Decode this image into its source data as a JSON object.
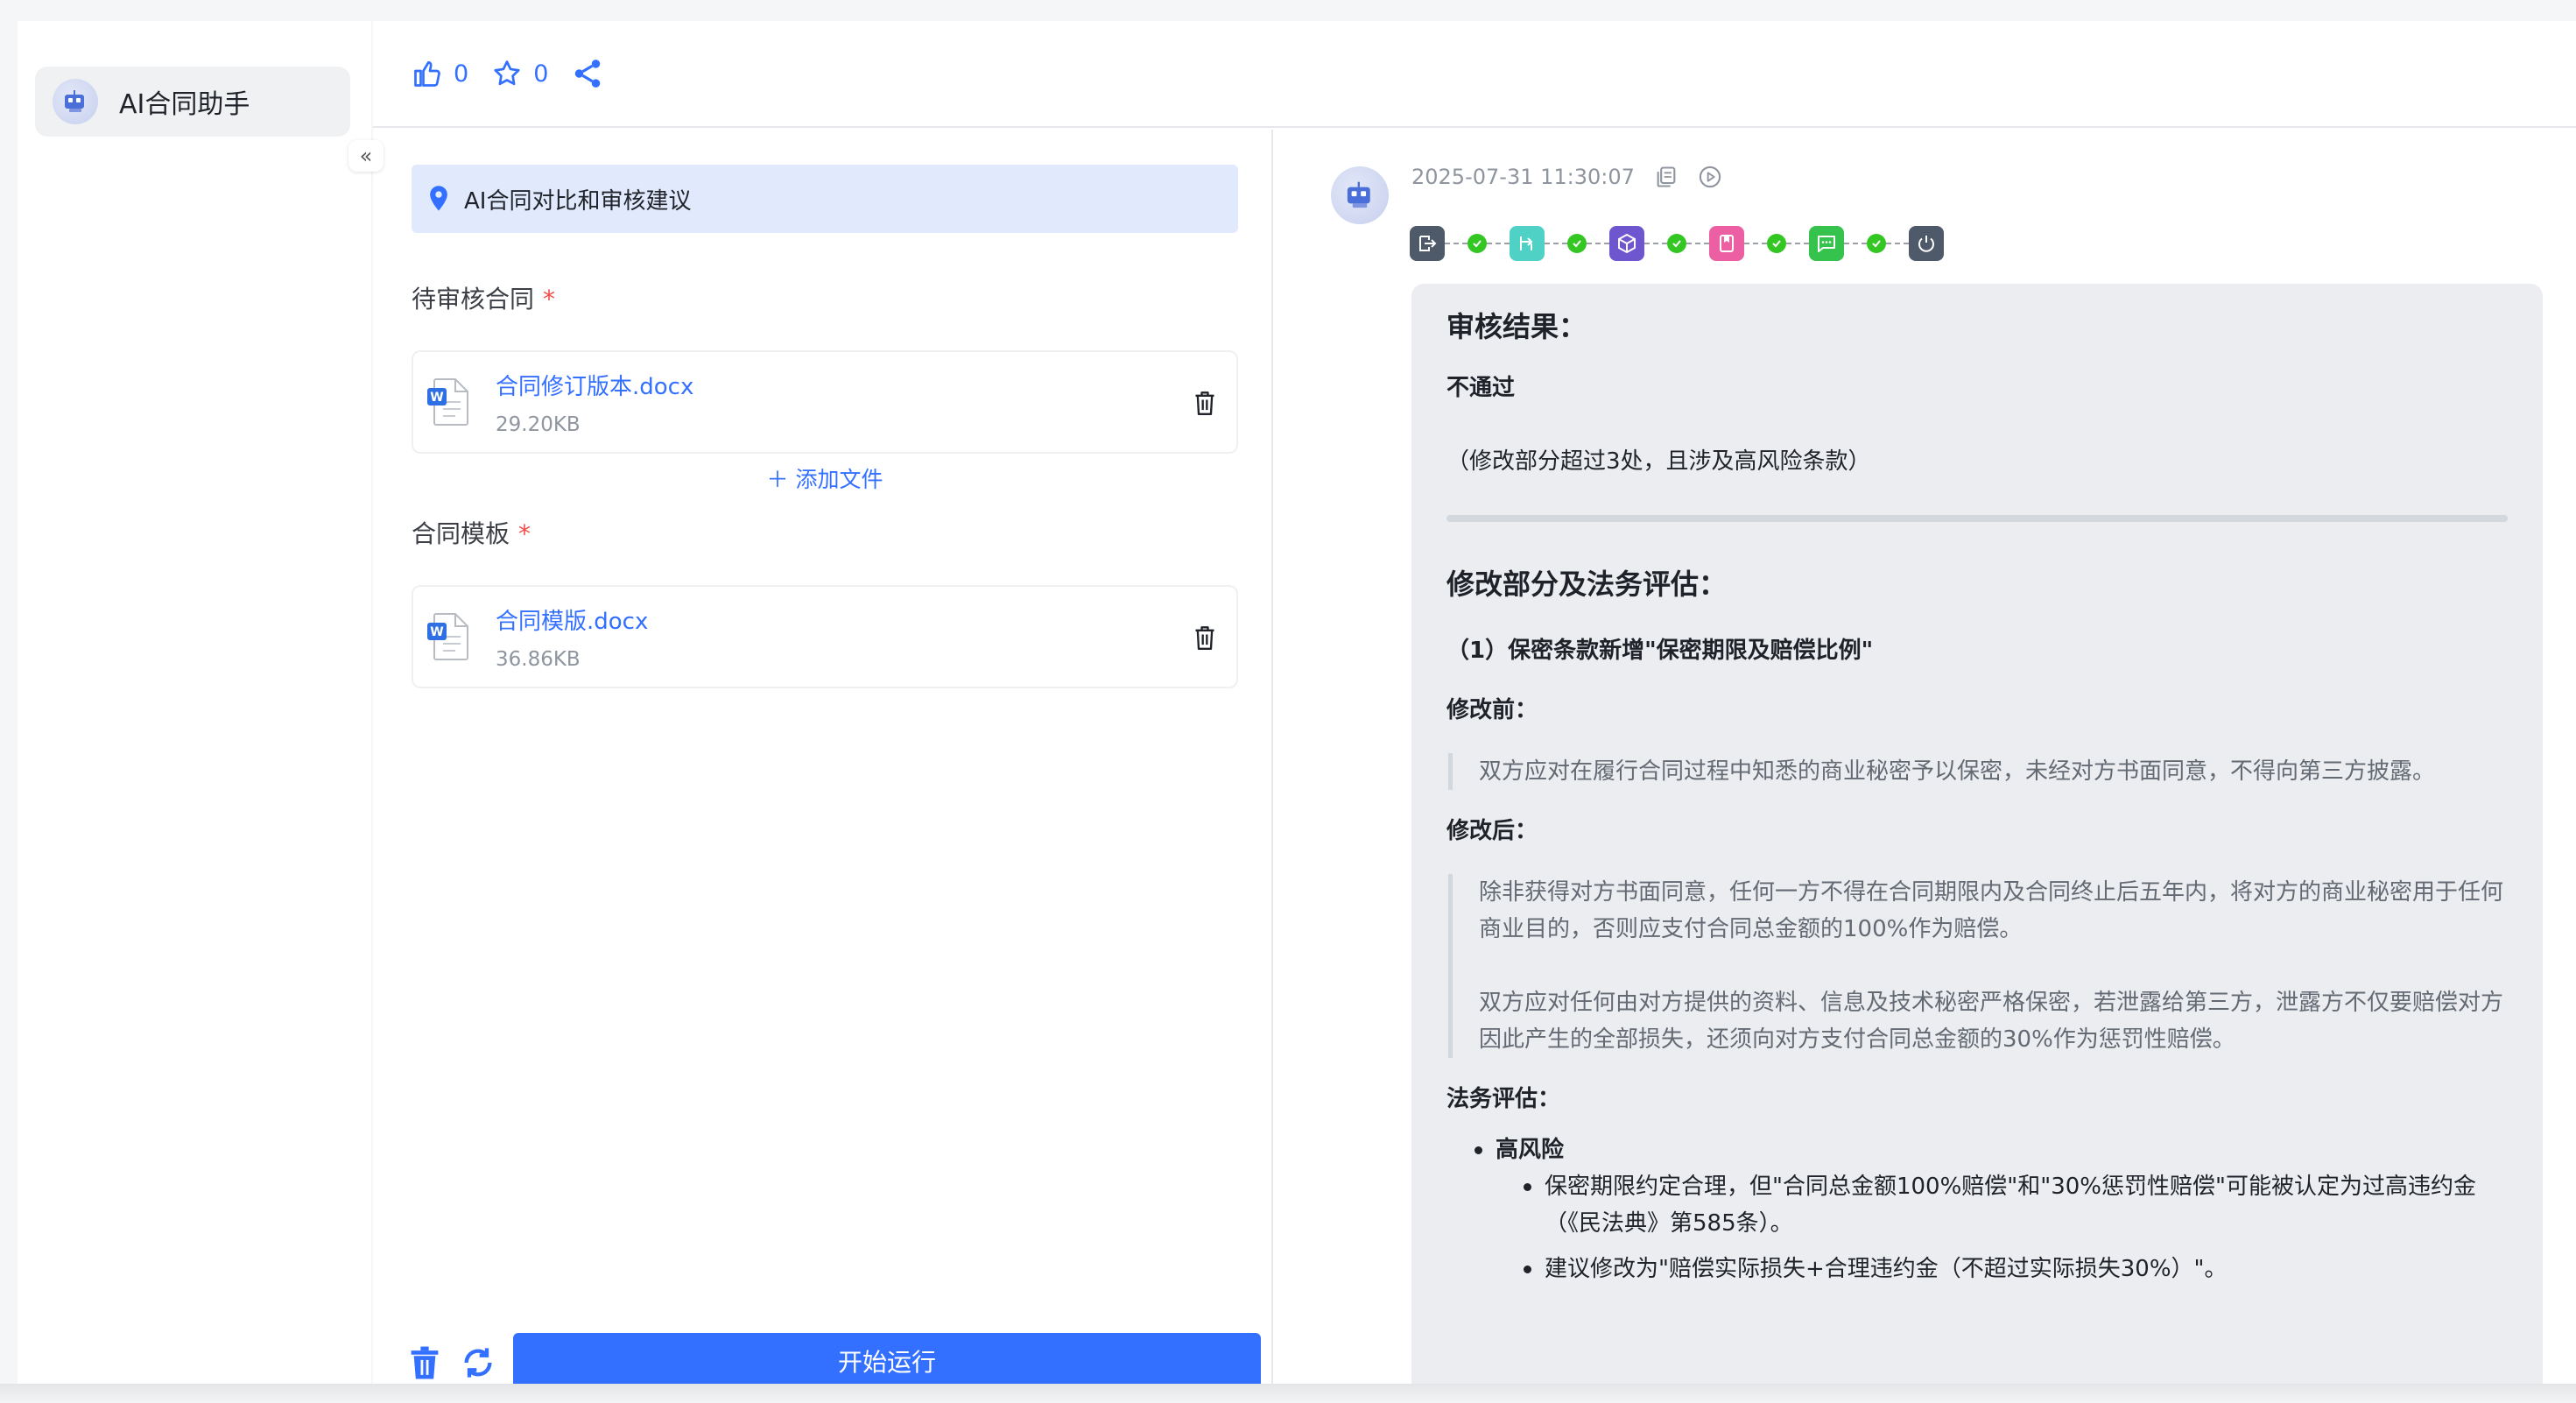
{
  "sidebar": {
    "app_name": "AI合同助手",
    "collapse_glyph": "«"
  },
  "toolbar": {
    "like_count": "0",
    "star_count": "0"
  },
  "form": {
    "banner_title": "AI合同对比和审核建议",
    "contract_label": "待审核合同",
    "template_label": "合同模板",
    "required_mark": "*",
    "contract_file": {
      "name": "合同修订版本.docx",
      "size": "29.20KB"
    },
    "template_file": {
      "name": "合同模版.docx",
      "size": "36.86KB"
    },
    "add_file_label": "＋ 添加文件",
    "run_label": "开始运行"
  },
  "result": {
    "timestamp": "2025-07-31 11:30:07",
    "workflow_colors": [
      "#4e5969",
      "#4fd1c5",
      "#6e56cf",
      "#ec5fa3",
      "#36c34d",
      "#4e5969"
    ],
    "audit_heading": "审核结果：",
    "verdict": "不通过",
    "verdict_reason": "（修改部分超过3处，且涉及高风险条款）",
    "changes_heading": "修改部分及法务评估：",
    "item1_title": "（1）保密条款新增\"保密期限及赔偿比例\"",
    "before_label": "修改前：",
    "before_text": "双方应对在履行合同过程中知悉的商业秘密予以保密，未经对方书面同意，不得向第三方披露。",
    "after_label": "修改后：",
    "after_text_1": "除非获得对方书面同意，任何一方不得在合同期限内及合同终止后五年内，将对方的商业秘密用于任何商业目的，否则应支付合同总金额的100%作为赔偿。",
    "after_text_2": "双方应对任何由对方提供的资料、信息及技术秘密严格保密，若泄露给第三方，泄露方不仅要赔偿对方因此产生的全部损失，还须向对方支付合同总金额的30%作为惩罚性赔偿。",
    "legal_label": "法务评估：",
    "risk_level": "高风险",
    "risk_points": [
      "保密期限约定合理，但\"合同总金额100%赔偿\"和\"30%惩罚性赔偿\"可能被认定为过高违约金（《民法典》第585条）。",
      "建议修改为\"赔偿实际损失+合理违约金（不超过实际损失30%）\"。"
    ]
  }
}
